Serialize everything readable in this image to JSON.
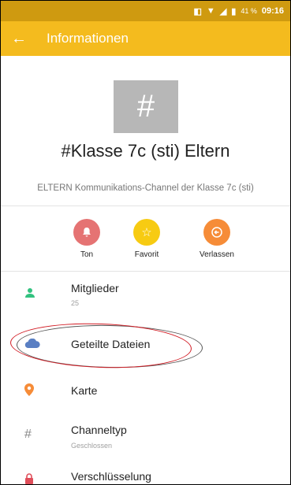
{
  "status_bar": {
    "battery": "41 %",
    "time": "09:16"
  },
  "app_bar": {
    "back_icon": "arrow-left",
    "title": "Informationen"
  },
  "channel": {
    "avatar_glyph": "#",
    "name": "#Klasse 7c (sti) Eltern",
    "description": "ELTERN Kommunikations-Channel der Klasse 7c (sti)"
  },
  "actions": [
    {
      "label": "Ton",
      "icon": "bell",
      "color": "#e57373"
    },
    {
      "label": "Favorit",
      "icon": "star",
      "color": "#f7cb12"
    },
    {
      "label": "Verlassen",
      "icon": "leave",
      "color": "#f68c38"
    }
  ],
  "list": [
    {
      "label": "Mitglieder",
      "sub": "25",
      "icon": "person",
      "color": "#32c27f"
    },
    {
      "label": "Geteilte Dateien",
      "icon": "cloud",
      "color": "#5a7fc3"
    },
    {
      "label": "Karte",
      "icon": "location-pin",
      "color": "#f68c38"
    },
    {
      "label": "Channeltyp",
      "sub": "Geschlossen",
      "icon": "hash",
      "color": "#888888"
    },
    {
      "label": "Verschlüsselung",
      "icon": "lock",
      "color": "#e04e5a"
    }
  ]
}
